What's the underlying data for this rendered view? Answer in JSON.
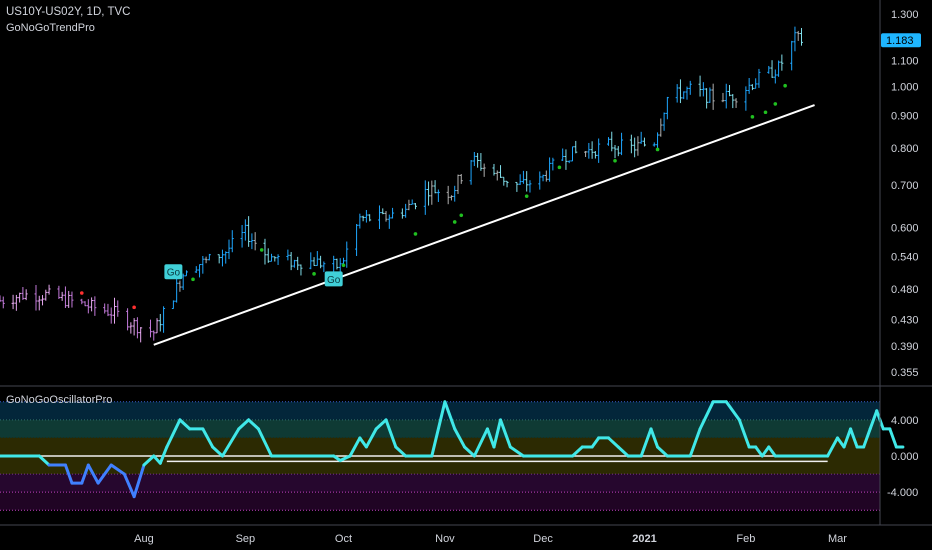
{
  "header": {
    "symbol": "US10Y-US02Y, 1D, TVC",
    "indicator": "GoNoGoTrendPro"
  },
  "oscillator": {
    "name": "GoNoGoOscillatorPro"
  },
  "colors": {
    "background": "#000000",
    "go_strong": "#1ea7ff",
    "go_weak": "#80deea",
    "nogo": "#c37adb",
    "nogo_weak": "#e6a8f0",
    "neutral": "#b0b0b0",
    "signal_dot": "#20c020",
    "red_dot": "#ff3030",
    "trendline": "#ffffff",
    "price_tag": "#1fb6ff",
    "osc_line": "#40e8e8",
    "osc_line_low": "#4080ff"
  },
  "chart_data": [
    {
      "type": "bar",
      "title": "US10Y-US02Y, 1D, TVC",
      "y_scale": "log",
      "ylim": [
        0.345,
        1.32
      ],
      "y_ticks": [
        "1.300",
        "1.100",
        "1.000",
        "0.900",
        "0.800",
        "0.700",
        "0.600",
        "0.540",
        "0.480",
        "0.430",
        "0.390",
        "0.355"
      ],
      "last_price": "1.183",
      "x_ticks": [
        "Aug",
        "Sep",
        "Oct",
        "Nov",
        "Dec",
        "2021",
        "Feb",
        "Mar"
      ],
      "x_tick_dates": [
        "2020-08-01",
        "2020-09-01",
        "2020-10-01",
        "2020-11-01",
        "2020-12-01",
        "2021-01-01",
        "2021-02-01",
        "2021-03-01"
      ],
      "x_range": [
        "2020-06-18",
        "2021-03-14"
      ],
      "close_series": [
        [
          "2020-06-18",
          0.46
        ],
        [
          "2020-06-25",
          0.47
        ],
        [
          "2020-07-02",
          0.47
        ],
        [
          "2020-07-09",
          0.46
        ],
        [
          "2020-07-16",
          0.45
        ],
        [
          "2020-07-23",
          0.44
        ],
        [
          "2020-07-30",
          0.42
        ],
        [
          "2020-08-04",
          0.41
        ],
        [
          "2020-08-10",
          0.47
        ],
        [
          "2020-08-14",
          0.52
        ],
        [
          "2020-08-20",
          0.53
        ],
        [
          "2020-08-26",
          0.55
        ],
        [
          "2020-09-01",
          0.59
        ],
        [
          "2020-09-08",
          0.54
        ],
        [
          "2020-09-15",
          0.53
        ],
        [
          "2020-09-22",
          0.53
        ],
        [
          "2020-09-30",
          0.52
        ],
        [
          "2020-10-06",
          0.62
        ],
        [
          "2020-10-13",
          0.62
        ],
        [
          "2020-10-20",
          0.64
        ],
        [
          "2020-10-27",
          0.69
        ],
        [
          "2020-11-03",
          0.68
        ],
        [
          "2020-11-09",
          0.77
        ],
        [
          "2020-11-16",
          0.73
        ],
        [
          "2020-11-23",
          0.7
        ],
        [
          "2020-11-30",
          0.71
        ],
        [
          "2020-12-07",
          0.78
        ],
        [
          "2020-12-14",
          0.79
        ],
        [
          "2020-12-21",
          0.81
        ],
        [
          "2020-12-28",
          0.8
        ],
        [
          "2021-01-04",
          0.82
        ],
        [
          "2021-01-08",
          0.96
        ],
        [
          "2021-01-15",
          0.99
        ],
        [
          "2021-01-22",
          0.96
        ],
        [
          "2021-01-29",
          0.97
        ],
        [
          "2021-02-05",
          1.03
        ],
        [
          "2021-02-11",
          1.07
        ],
        [
          "2021-02-16",
          1.19
        ],
        [
          "2021-02-18",
          1.183
        ]
      ],
      "trendline": {
        "start": [
          "2020-08-04",
          0.392
        ],
        "end": [
          "2021-02-22",
          0.935
        ]
      },
      "go_labels": [
        {
          "text": "Go",
          "date": "2020-08-10",
          "value": 0.51
        },
        {
          "text": "Go",
          "date": "2020-09-28",
          "value": 0.497
        }
      ],
      "signal_dots": [
        [
          "2020-08-16",
          0.497
        ],
        [
          "2020-09-06",
          0.553
        ],
        [
          "2020-09-22",
          0.507
        ],
        [
          "2020-10-01",
          0.523
        ],
        [
          "2020-10-23",
          0.586
        ],
        [
          "2020-11-04",
          0.612
        ],
        [
          "2020-11-06",
          0.627
        ],
        [
          "2020-11-26",
          0.672
        ],
        [
          "2020-12-06",
          0.746
        ],
        [
          "2020-12-23",
          0.764
        ],
        [
          "2021-01-05",
          0.796
        ],
        [
          "2021-02-03",
          0.896
        ],
        [
          "2021-02-07",
          0.911
        ],
        [
          "2021-02-10",
          0.939
        ],
        [
          "2021-02-13",
          1.003
        ]
      ],
      "red_dots": [
        [
          "2020-07-13",
          0.473
        ],
        [
          "2020-07-29",
          0.449
        ]
      ]
    },
    {
      "type": "line",
      "title": "GoNoGoOscillatorPro",
      "ylim": [
        -6.2,
        6.2
      ],
      "y_ticks": [
        "4.000",
        "0.000",
        "-4.000"
      ],
      "y_tick_values": [
        4,
        0,
        -4
      ],
      "bands": [
        6,
        4,
        2,
        0,
        -2,
        -4,
        -6
      ],
      "threshold_lines": [
        0,
        -0.6
      ],
      "series": [
        {
          "values": [
            [
              "2020-06-18",
              0
            ],
            [
              "2020-06-30",
              0
            ],
            [
              "2020-07-03",
              -1
            ],
            [
              "2020-07-08",
              -1
            ],
            [
              "2020-07-10",
              -3
            ],
            [
              "2020-07-13",
              -3
            ],
            [
              "2020-07-15",
              -1
            ],
            [
              "2020-07-18",
              -3
            ],
            [
              "2020-07-22",
              -1
            ],
            [
              "2020-07-26",
              -2
            ],
            [
              "2020-07-29",
              -4.5
            ],
            [
              "2020-08-01",
              -1
            ],
            [
              "2020-08-04",
              0
            ],
            [
              "2020-08-06",
              -0.8
            ],
            [
              "2020-08-08",
              1
            ],
            [
              "2020-08-12",
              4
            ],
            [
              "2020-08-15",
              3
            ],
            [
              "2020-08-19",
              3
            ],
            [
              "2020-08-22",
              1
            ],
            [
              "2020-08-25",
              0
            ],
            [
              "2020-08-30",
              3
            ],
            [
              "2020-09-02",
              4
            ],
            [
              "2020-09-05",
              3
            ],
            [
              "2020-09-09",
              0
            ],
            [
              "2020-09-28",
              0
            ],
            [
              "2020-09-30",
              -0.5
            ],
            [
              "2020-10-03",
              0
            ],
            [
              "2020-10-06",
              2
            ],
            [
              "2020-10-08",
              1
            ],
            [
              "2020-10-11",
              3
            ],
            [
              "2020-10-14",
              4
            ],
            [
              "2020-10-17",
              1
            ],
            [
              "2020-10-20",
              0
            ],
            [
              "2020-10-28",
              0
            ],
            [
              "2020-11-01",
              6
            ],
            [
              "2020-11-04",
              3
            ],
            [
              "2020-11-07",
              1
            ],
            [
              "2020-11-10",
              0
            ],
            [
              "2020-11-14",
              3
            ],
            [
              "2020-11-16",
              1
            ],
            [
              "2020-11-18",
              4
            ],
            [
              "2020-11-21",
              1
            ],
            [
              "2020-11-25",
              0
            ],
            [
              "2020-12-10",
              0
            ],
            [
              "2020-12-13",
              1
            ],
            [
              "2020-12-16",
              1
            ],
            [
              "2020-12-18",
              2
            ],
            [
              "2020-12-21",
              2
            ],
            [
              "2020-12-24",
              1
            ],
            [
              "2020-12-27",
              0
            ],
            [
              "2020-12-31",
              0
            ],
            [
              "2021-01-03",
              3
            ],
            [
              "2021-01-05",
              1
            ],
            [
              "2021-01-08",
              0
            ],
            [
              "2021-01-15",
              0
            ],
            [
              "2021-01-18",
              3
            ],
            [
              "2021-01-22",
              6
            ],
            [
              "2021-01-26",
              6
            ],
            [
              "2021-01-30",
              4
            ],
            [
              "2021-02-02",
              1
            ],
            [
              "2021-02-04",
              1
            ],
            [
              "2021-02-06",
              0
            ],
            [
              "2021-02-08",
              1
            ],
            [
              "2021-02-10",
              0
            ],
            [
              "2021-02-22",
              0
            ],
            [
              "2021-02-26",
              0
            ],
            [
              "2021-03-01",
              2
            ],
            [
              "2021-03-03",
              1
            ],
            [
              "2021-03-05",
              3
            ],
            [
              "2021-03-07",
              1
            ],
            [
              "2021-03-09",
              1
            ],
            [
              "2021-03-11",
              3
            ],
            [
              "2021-03-13",
              5
            ],
            [
              "2021-03-15",
              3
            ],
            [
              "2021-03-17",
              3
            ],
            [
              "2021-03-19",
              1
            ],
            [
              "2021-03-21",
              1
            ]
          ]
        }
      ]
    }
  ]
}
